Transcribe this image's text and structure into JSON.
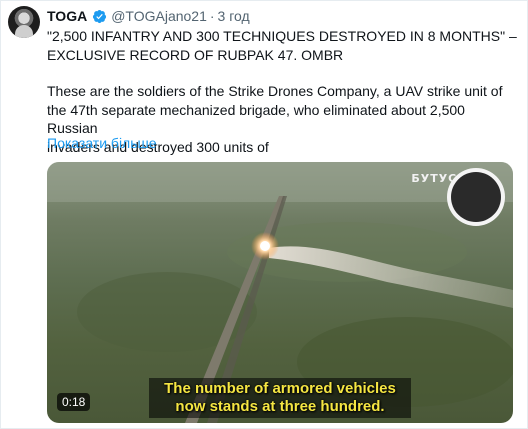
{
  "author": {
    "name": "TOGA",
    "handle": "@TOGAjano21",
    "separator": "·",
    "time": "3 год",
    "verified_icon": "verified-badge-icon"
  },
  "tweet": {
    "line1": "\"2,500 INFANTRY AND 300 TECHNIQUES DESTROYED IN 8 MONTHS\" –",
    "line2": "EXCLUSIVE RECORD OF RUBPAK 47. OMBR",
    "body_line1": "These are the soldiers of the Strike Drones Company, a UAV strike unit of",
    "body_line2": "the 47th separate mechanized brigade, who eliminated about 2,500 Russian",
    "body_line3": "invaders and destroyed 300 units of",
    "show_more": "Показати більше"
  },
  "video": {
    "watermark": "БУТУСОВ",
    "subtitle_line1": "The number of armored vehicles",
    "subtitle_line2": "now stands at three hundred.",
    "duration": "0:18"
  },
  "colors": {
    "link": "#1d9bf0",
    "muted": "#536471",
    "subtitle": "#f5e642"
  }
}
